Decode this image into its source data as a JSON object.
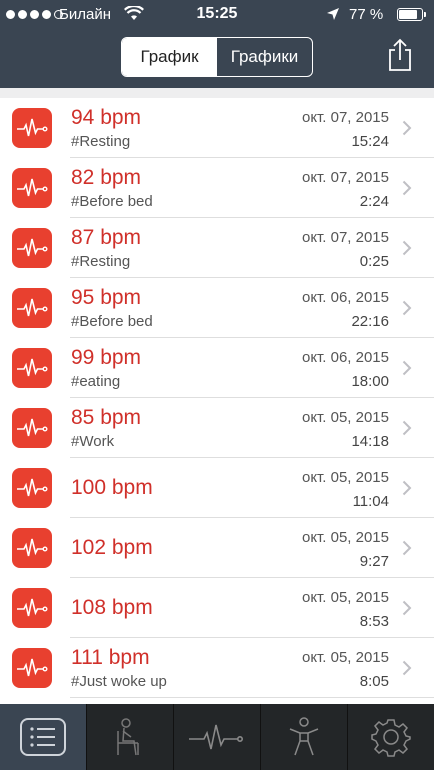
{
  "status": {
    "carrier": "Билайн",
    "time": "15:25",
    "battery": "77 %",
    "battery_level": 0.77
  },
  "header": {
    "segments": [
      "График",
      "Графики"
    ],
    "active_segment": 0
  },
  "readings": [
    {
      "bpm": "94 bpm",
      "tag": "#Resting",
      "date": "окт. 07, 2015",
      "time": "15:24"
    },
    {
      "bpm": "82 bpm",
      "tag": "#Before bed",
      "date": "окт. 07, 2015",
      "time": "2:24"
    },
    {
      "bpm": "87 bpm",
      "tag": "#Resting",
      "date": "окт. 07, 2015",
      "time": "0:25"
    },
    {
      "bpm": "95 bpm",
      "tag": "#Before bed",
      "date": "окт. 06, 2015",
      "time": "22:16"
    },
    {
      "bpm": "99 bpm",
      "tag": "#eating",
      "date": "окт. 06, 2015",
      "time": "18:00"
    },
    {
      "bpm": "85 bpm",
      "tag": "#Work",
      "date": "окт. 05, 2015",
      "time": "14:18"
    },
    {
      "bpm": "100 bpm",
      "tag": "",
      "date": "окт. 05, 2015",
      "time": "11:04"
    },
    {
      "bpm": "102 bpm",
      "tag": "",
      "date": "окт. 05, 2015",
      "time": "9:27"
    },
    {
      "bpm": "108 bpm",
      "tag": "",
      "date": "окт. 05, 2015",
      "time": "8:53"
    },
    {
      "bpm": "111 bpm",
      "tag": "#Just woke up",
      "date": "окт. 05, 2015",
      "time": "8:05"
    }
  ],
  "tabbar": {
    "tabs": [
      "list-icon",
      "sitting-person-icon",
      "heartbeat-icon",
      "standing-person-icon",
      "gear-icon"
    ],
    "active_tab": 0
  },
  "colors": {
    "header_bg": "#3a4552",
    "accent_red": "#e8402f",
    "bpm_text": "#d0302a",
    "tabbar_bg": "#232628"
  }
}
